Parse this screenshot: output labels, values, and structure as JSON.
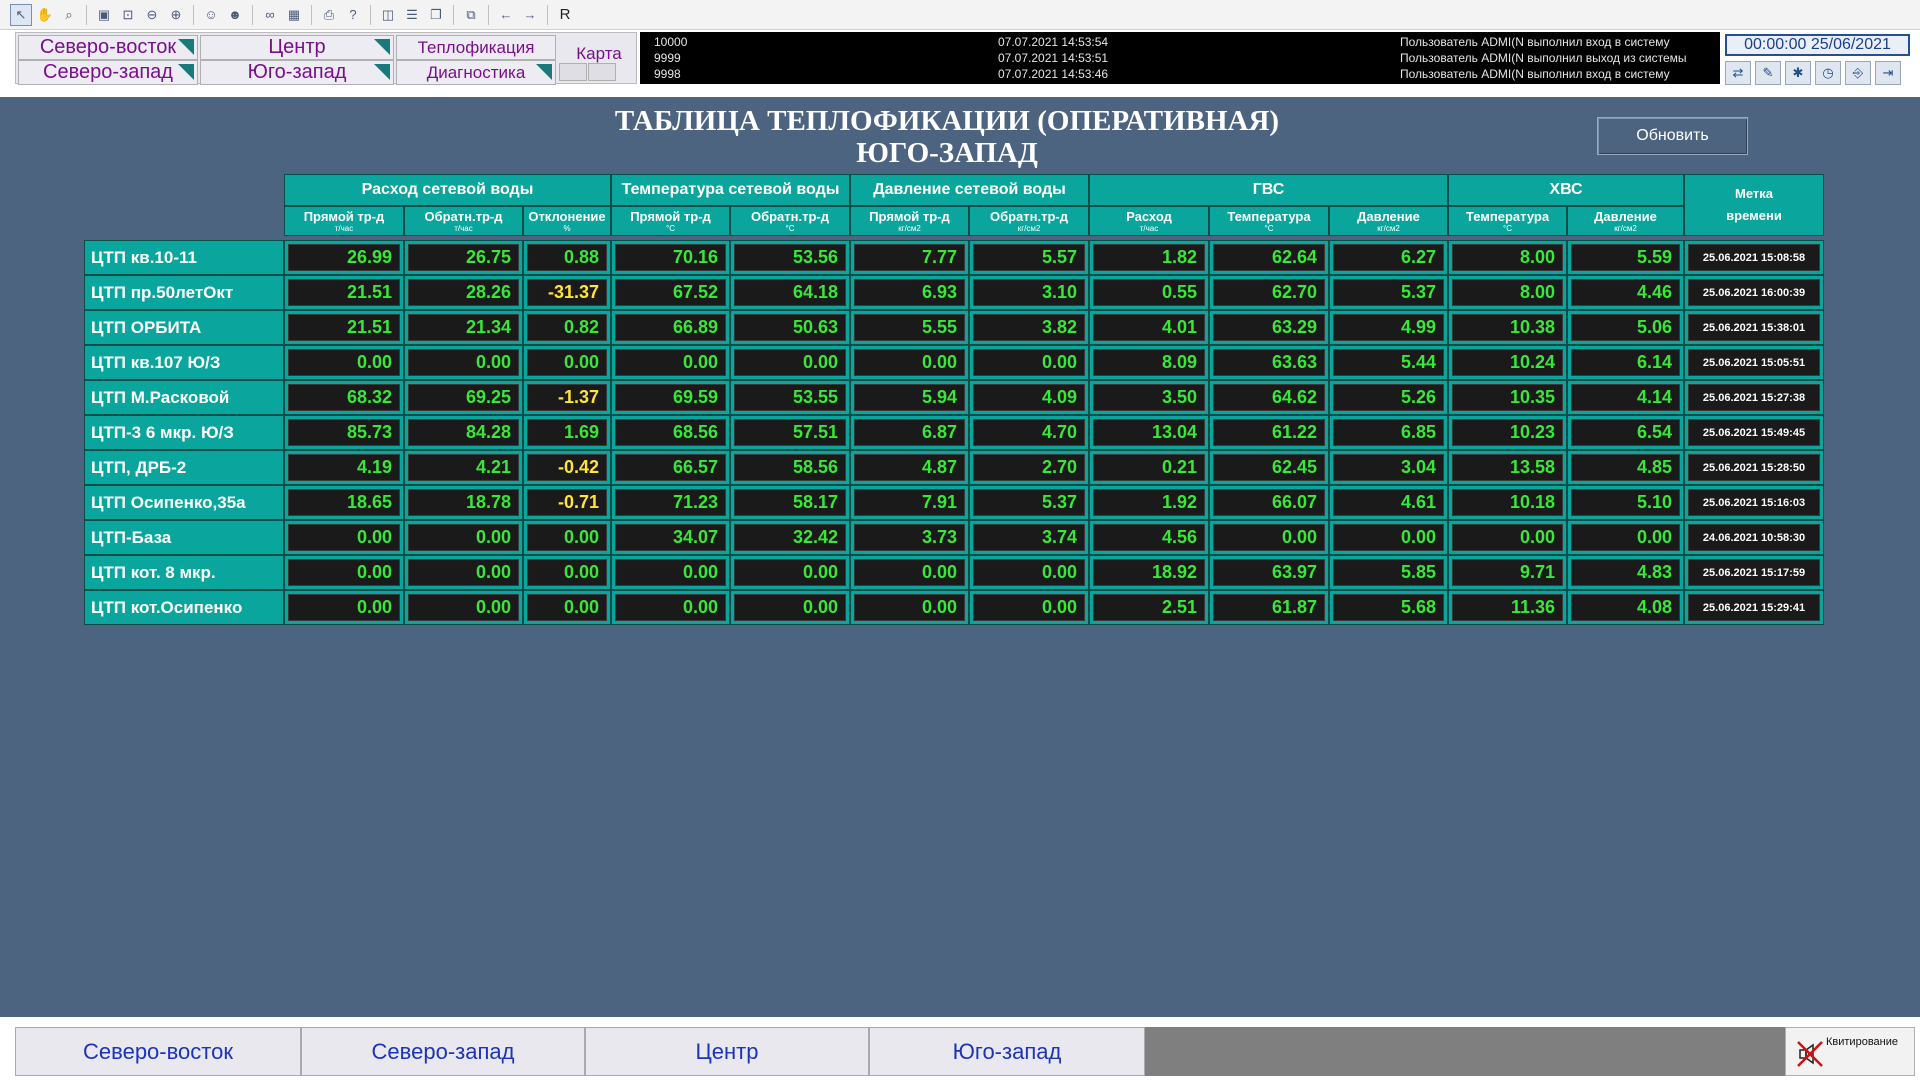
{
  "topnav": {
    "tabs": [
      {
        "label": "Северо-восток"
      },
      {
        "label": "Центр"
      },
      {
        "label": "Теплофикация"
      },
      {
        "label": "Северо-запад"
      },
      {
        "label": "Юго-запад"
      },
      {
        "label": "Диагностика"
      }
    ],
    "karta": "Карта"
  },
  "events": [
    {
      "id": "10000",
      "time": "07.07.2021 14:53:54",
      "msg": "Пользователь ADMI(N выполнил вход в систему"
    },
    {
      "id": "9999",
      "time": "07.07.2021 14:53:51",
      "msg": "Пользователь ADMI(N выполнил выход из системы"
    },
    {
      "id": "9998",
      "time": "07.07.2021 14:53:46",
      "msg": "Пользователь ADMI(N выполнил вход в систему"
    }
  ],
  "clock": "00:00:00 25/06/2021",
  "title": {
    "line1": "ТАБЛИЦА ТЕПЛОФИКАЦИИ (ОПЕРАТИВНАЯ)",
    "line2": "ЮГО-ЗАПАД"
  },
  "refresh_label": "Обновить",
  "groups": [
    {
      "label": "Расход сетевой воды"
    },
    {
      "label": "Температура сетевой воды"
    },
    {
      "label": "Давление сетевой воды"
    },
    {
      "label": "ГВС"
    },
    {
      "label": "ХВС"
    }
  ],
  "time_header": {
    "line1": "Метка",
    "line2": "времени"
  },
  "subheaders": [
    {
      "name": "Прямой тр-д",
      "unit": "т/час"
    },
    {
      "name": "Обратн.тр-д",
      "unit": "т/час"
    },
    {
      "name": "Отклонение",
      "unit": "%"
    },
    {
      "name": "Прямой тр-д",
      "unit": "°С"
    },
    {
      "name": "Обратн.тр-д",
      "unit": "°С"
    },
    {
      "name": "Прямой тр-д",
      "unit": "кг/см2"
    },
    {
      "name": "Обратн.тр-д",
      "unit": "кг/см2"
    },
    {
      "name": "Расход",
      "unit": "т/час"
    },
    {
      "name": "Температура",
      "unit": "°С"
    },
    {
      "name": "Давление",
      "unit": "кг/см2"
    },
    {
      "name": "Температура",
      "unit": "°С"
    },
    {
      "name": "Давление",
      "unit": "кг/см2"
    }
  ],
  "rows": [
    {
      "name": "ЦТП кв.10-11",
      "values": [
        "26.99",
        "26.75",
        "0.88",
        "70.16",
        "53.56",
        "7.77",
        "5.57",
        "1.82",
        "62.64",
        "6.27",
        "8.00",
        "5.59"
      ],
      "warn": [],
      "ts": "25.06.2021 15:08:58"
    },
    {
      "name": "ЦТП пр.50летОкт",
      "values": [
        "21.51",
        "28.26",
        "-31.37",
        "67.52",
        "64.18",
        "6.93",
        "3.10",
        "0.55",
        "62.70",
        "5.37",
        "8.00",
        "4.46"
      ],
      "warn": [
        2
      ],
      "ts": "25.06.2021 16:00:39"
    },
    {
      "name": "ЦТП ОРБИТА",
      "values": [
        "21.51",
        "21.34",
        "0.82",
        "66.89",
        "50.63",
        "5.55",
        "3.82",
        "4.01",
        "63.29",
        "4.99",
        "10.38",
        "5.06"
      ],
      "warn": [],
      "ts": "25.06.2021 15:38:01"
    },
    {
      "name": "ЦТП кв.107 Ю/З",
      "values": [
        "0.00",
        "0.00",
        "0.00",
        "0.00",
        "0.00",
        "0.00",
        "0.00",
        "8.09",
        "63.63",
        "5.44",
        "10.24",
        "6.14"
      ],
      "warn": [],
      "ts": "25.06.2021 15:05:51"
    },
    {
      "name": "ЦТП М.Расковой",
      "values": [
        "68.32",
        "69.25",
        "-1.37",
        "69.59",
        "53.55",
        "5.94",
        "4.09",
        "3.50",
        "64.62",
        "5.26",
        "10.35",
        "4.14"
      ],
      "warn": [
        2
      ],
      "ts": "25.06.2021 15:27:38"
    },
    {
      "name": "ЦТП-3 6 мкр. Ю/З",
      "values": [
        "85.73",
        "84.28",
        "1.69",
        "68.56",
        "57.51",
        "6.87",
        "4.70",
        "13.04",
        "61.22",
        "6.85",
        "10.23",
        "6.54"
      ],
      "warn": [],
      "ts": "25.06.2021 15:49:45"
    },
    {
      "name": "ЦТП, ДРБ-2",
      "values": [
        "4.19",
        "4.21",
        "-0.42",
        "66.57",
        "58.56",
        "4.87",
        "2.70",
        "0.21",
        "62.45",
        "3.04",
        "13.58",
        "4.85"
      ],
      "warn": [
        2
      ],
      "ts": "25.06.2021 15:28:50"
    },
    {
      "name": "ЦТП Осипенко,35а",
      "values": [
        "18.65",
        "18.78",
        "-0.71",
        "71.23",
        "58.17",
        "7.91",
        "5.37",
        "1.92",
        "66.07",
        "4.61",
        "10.18",
        "5.10"
      ],
      "warn": [
        2
      ],
      "ts": "25.06.2021 15:16:03"
    },
    {
      "name": "ЦТП-База",
      "values": [
        "0.00",
        "0.00",
        "0.00",
        "34.07",
        "32.42",
        "3.73",
        "3.74",
        "4.56",
        "0.00",
        "0.00",
        "0.00",
        "0.00"
      ],
      "warn": [],
      "ts": "24.06.2021 10:58:30"
    },
    {
      "name": "ЦТП кот. 8 мкр.",
      "values": [
        "0.00",
        "0.00",
        "0.00",
        "0.00",
        "0.00",
        "0.00",
        "0.00",
        "18.92",
        "63.97",
        "5.85",
        "9.71",
        "4.83"
      ],
      "warn": [],
      "ts": "25.06.2021 15:17:59"
    },
    {
      "name": "ЦТП кот.Осипенко",
      "values": [
        "0.00",
        "0.00",
        "0.00",
        "0.00",
        "0.00",
        "0.00",
        "0.00",
        "2.51",
        "61.87",
        "5.68",
        "11.36",
        "4.08"
      ],
      "warn": [],
      "ts": "25.06.2021 15:29:41"
    }
  ],
  "bottomnav": {
    "tabs": [
      {
        "label": "Северо-восток"
      },
      {
        "label": "Северо-запад"
      },
      {
        "label": "Центр"
      },
      {
        "label": "Юго-запад"
      }
    ],
    "ack_label": "Квитирование"
  }
}
